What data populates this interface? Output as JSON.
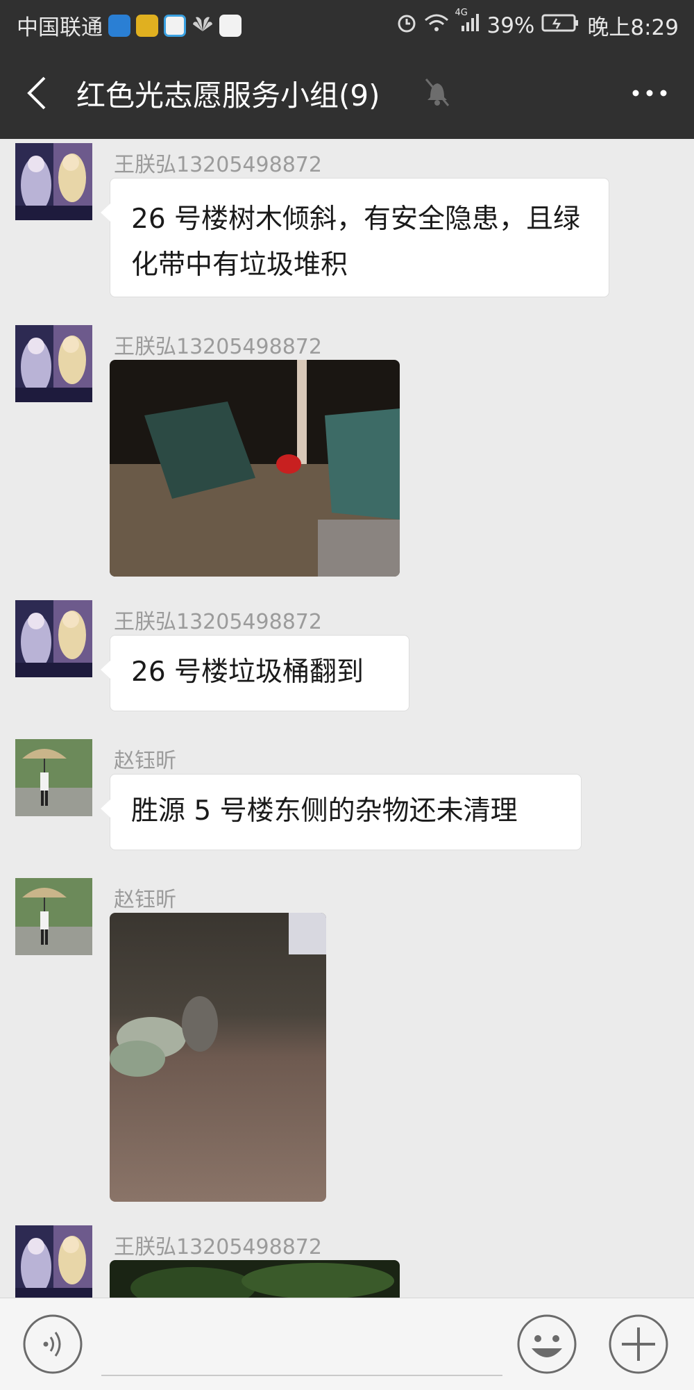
{
  "status_bar": {
    "carrier": "中国联通",
    "network": "4G",
    "battery": "39%",
    "time": "晚上8:29",
    "icons": [
      "shield-app-icon",
      "green-app-icon",
      "browser-app-icon",
      "huawei-icon",
      "video-app-icon",
      "alarm-icon",
      "wifi-icon",
      "signal-icon",
      "battery-icon"
    ]
  },
  "header": {
    "title": "红色光志愿服务小组(9)",
    "icons": [
      "back-icon",
      "mute-icon",
      "more-icon"
    ]
  },
  "messages": [
    {
      "sender": "王朕弘13205498872",
      "avatar": "anime-avatar",
      "type": "text",
      "text": "26 号楼树木倾斜，有安全隐患，且绿化带中有垃圾堆积"
    },
    {
      "sender": "王朕弘13205498872",
      "avatar": "anime-avatar",
      "type": "image",
      "image": "night-photo-overturned-bins"
    },
    {
      "sender": "王朕弘13205498872",
      "avatar": "anime-avatar",
      "type": "text",
      "text": "26 号楼垃圾桶翻到"
    },
    {
      "sender": "赵钰昕",
      "avatar": "umbrella-avatar",
      "type": "text",
      "text": "胜源 5 号楼东侧的杂物还未清理"
    },
    {
      "sender": "赵钰昕",
      "avatar": "umbrella-avatar",
      "type": "image",
      "image": "blurry-photo-debris"
    },
    {
      "sender": "王朕弘13205498872",
      "avatar": "anime-avatar",
      "type": "image",
      "image": "night-photo-trees-partial"
    }
  ],
  "input_bar": {
    "value": "",
    "icons": [
      "voice-icon",
      "emoji-icon",
      "plus-icon"
    ]
  },
  "colors": {
    "bar": "#303030",
    "background": "#ebebeb",
    "bubble": "#ffffff",
    "sender_text": "#9b9b9b"
  }
}
